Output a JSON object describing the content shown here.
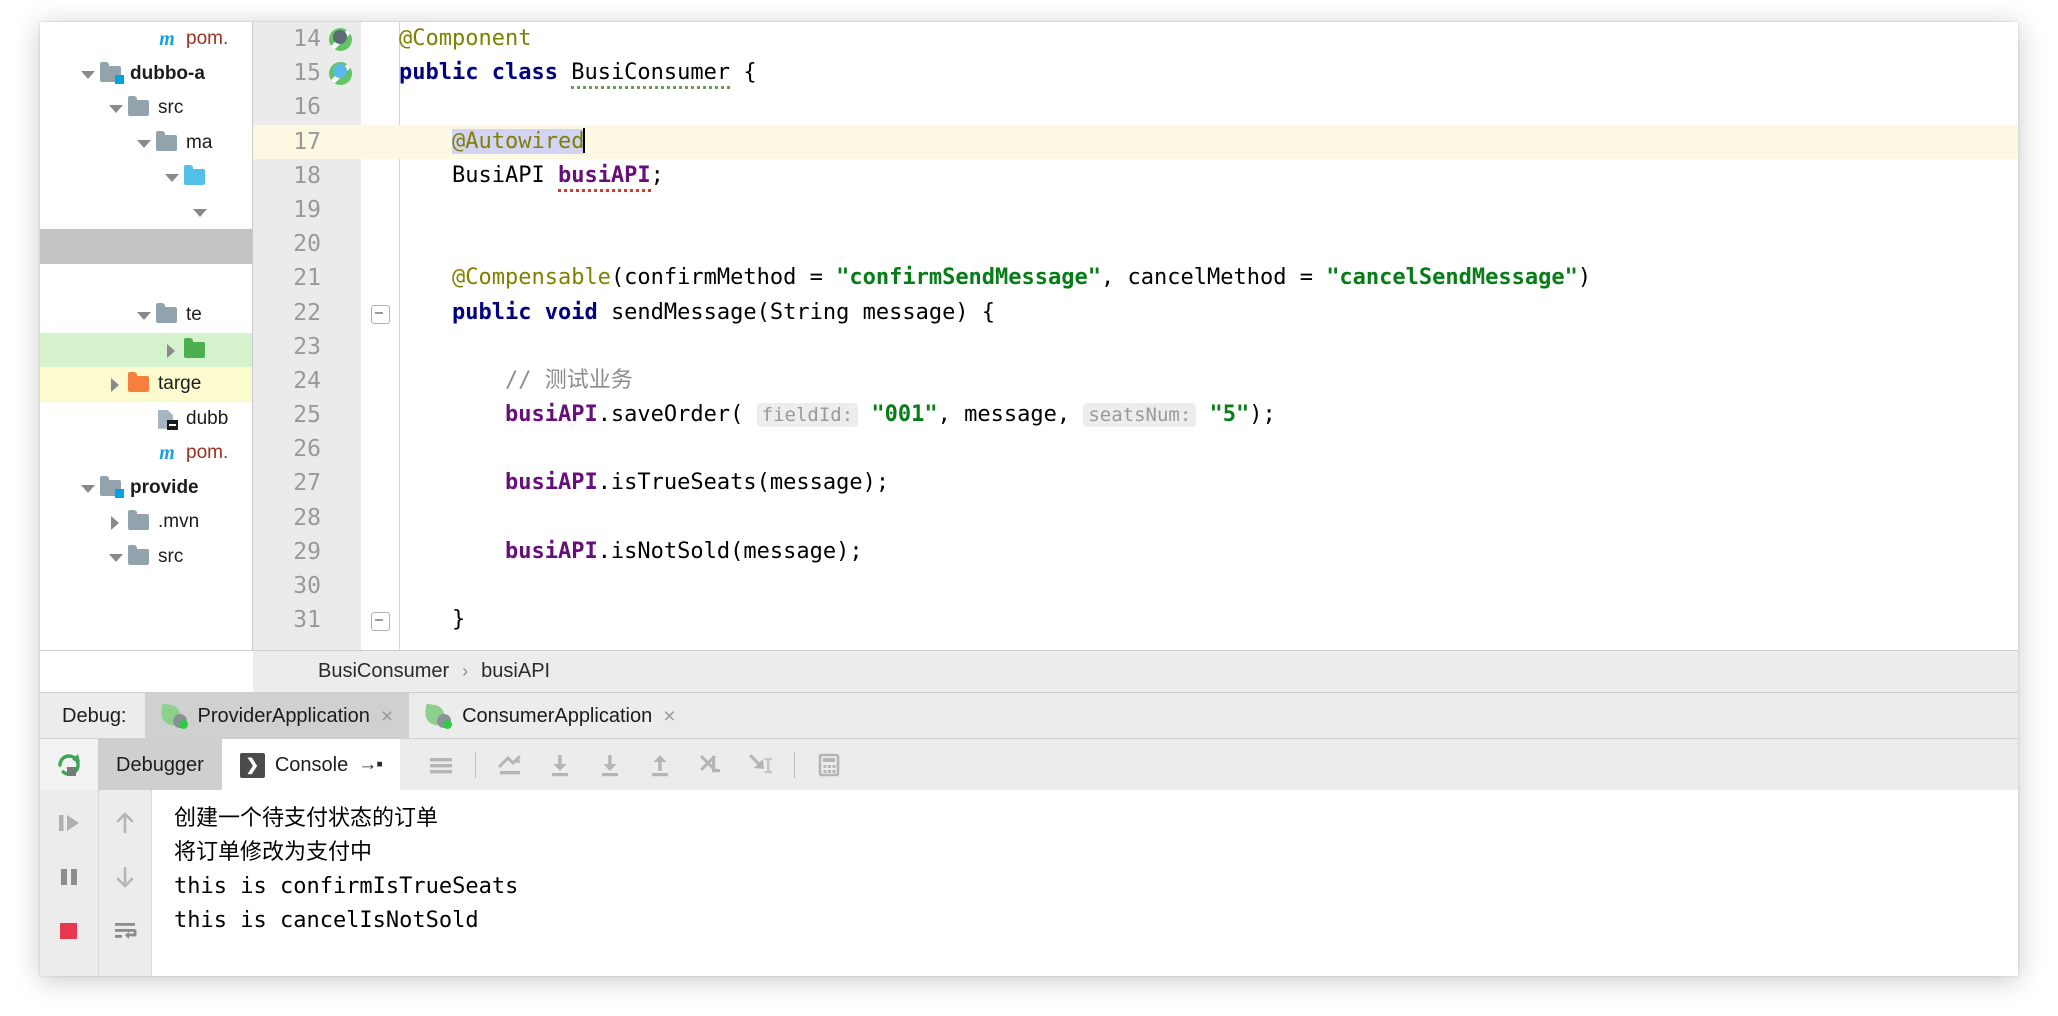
{
  "project_tree": {
    "items": [
      {
        "id": "pom-top",
        "indent": 3,
        "arrow": "none",
        "icon": "maven-pom-icon",
        "label": "pom.",
        "bold": false,
        "red": true,
        "highlight": "none"
      },
      {
        "id": "dubbo-a",
        "indent": 1,
        "arrow": "down",
        "icon": "module-folder-icon",
        "label": "dubbo-a",
        "bold": true,
        "red": false,
        "highlight": "none"
      },
      {
        "id": "src",
        "indent": 2,
        "arrow": "down",
        "icon": "folder-grey-icon",
        "label": "src",
        "bold": false,
        "red": false,
        "highlight": "none"
      },
      {
        "id": "main",
        "indent": 3,
        "arrow": "down",
        "icon": "folder-grey-icon",
        "label": "ma",
        "bold": false,
        "red": false,
        "highlight": "none"
      },
      {
        "id": "java",
        "indent": 4,
        "arrow": "down",
        "icon": "folder-blue-icon",
        "label": "",
        "bold": false,
        "red": false,
        "highlight": "none"
      },
      {
        "id": "pkg",
        "indent": 5,
        "arrow": "down",
        "icon": "none",
        "label": "",
        "bold": false,
        "red": false,
        "highlight": "none"
      },
      {
        "id": "selected-grey",
        "indent": 0,
        "arrow": "none",
        "icon": "none",
        "label": "",
        "bold": false,
        "red": false,
        "highlight": "grey"
      },
      {
        "id": "blank-a",
        "indent": 0,
        "arrow": "none",
        "icon": "none",
        "label": "",
        "bold": false,
        "red": false,
        "highlight": "none"
      },
      {
        "id": "test",
        "indent": 3,
        "arrow": "down",
        "icon": "folder-grey-icon",
        "label": "te",
        "bold": false,
        "red": false,
        "highlight": "none"
      },
      {
        "id": "resources",
        "indent": 4,
        "arrow": "right",
        "icon": "folder-green-icon",
        "label": "",
        "bold": false,
        "red": false,
        "highlight": "green"
      },
      {
        "id": "target",
        "indent": 2,
        "arrow": "right",
        "icon": "folder-orange-icon",
        "label": "targe",
        "bold": false,
        "red": false,
        "highlight": "yellow"
      },
      {
        "id": "dubbo-xml",
        "indent": 3,
        "arrow": "none",
        "icon": "xml-file-icon",
        "label": "dubb",
        "bold": false,
        "red": false,
        "highlight": "none"
      },
      {
        "id": "pom-mid",
        "indent": 3,
        "arrow": "none",
        "icon": "maven-pom-icon",
        "label": "pom.",
        "bold": false,
        "red": true,
        "highlight": "none"
      },
      {
        "id": "provider",
        "indent": 1,
        "arrow": "down",
        "icon": "module-folder-icon",
        "label": "provide",
        "bold": true,
        "red": false,
        "highlight": "none"
      },
      {
        "id": "mvn",
        "indent": 2,
        "arrow": "right",
        "icon": "folder-grey-icon",
        "label": ".mvn",
        "bold": false,
        "red": false,
        "highlight": "none"
      },
      {
        "id": "src2",
        "indent": 2,
        "arrow": "down",
        "icon": "folder-grey-icon",
        "label": "src",
        "bold": false,
        "red": false,
        "highlight": "none"
      }
    ]
  },
  "editor": {
    "lines": [
      {
        "no": "14",
        "gutter_icon": "spring-bean-icon",
        "fold": false,
        "highlight": false,
        "tokens": [
          {
            "t": "@Component",
            "c": "ann"
          }
        ]
      },
      {
        "no": "15",
        "gutter_icon": "spring-config-icon",
        "fold": false,
        "highlight": false,
        "tokens": [
          {
            "t": "public ",
            "c": "kw"
          },
          {
            "t": "class ",
            "c": "kw"
          },
          {
            "t": "BusiConsumer",
            "c": "plain wavy-green"
          },
          {
            "t": " {",
            "c": "plain"
          }
        ]
      },
      {
        "no": "16",
        "gutter_icon": "none",
        "fold": false,
        "highlight": false,
        "tokens": []
      },
      {
        "no": "17",
        "gutter_icon": "none",
        "fold": false,
        "highlight": true,
        "tokens": [
          {
            "t": "    ",
            "c": "plain"
          },
          {
            "t": "@Autowired",
            "c": "ann sel-token"
          },
          {
            "t": "|CARET|",
            "c": "caret"
          }
        ]
      },
      {
        "no": "18",
        "gutter_icon": "none",
        "fold": false,
        "highlight": false,
        "tokens": [
          {
            "t": "    BusiAPI ",
            "c": "plain"
          },
          {
            "t": "busiAPI",
            "c": "fld wavy-red"
          },
          {
            "t": ";",
            "c": "plain"
          }
        ]
      },
      {
        "no": "19",
        "gutter_icon": "none",
        "fold": false,
        "highlight": false,
        "tokens": []
      },
      {
        "no": "20",
        "gutter_icon": "none",
        "fold": false,
        "highlight": false,
        "tokens": []
      },
      {
        "no": "21",
        "gutter_icon": "none",
        "fold": false,
        "highlight": false,
        "tokens": [
          {
            "t": "    ",
            "c": "plain"
          },
          {
            "t": "@Compensable",
            "c": "ann"
          },
          {
            "t": "(confirmMethod = ",
            "c": "plain"
          },
          {
            "t": "\"confirmSendMessage\"",
            "c": "str"
          },
          {
            "t": ", cancelMethod = ",
            "c": "plain"
          },
          {
            "t": "\"cancelSendMessage\"",
            "c": "str"
          },
          {
            "t": ")",
            "c": "plain"
          }
        ]
      },
      {
        "no": "22",
        "gutter_icon": "none",
        "fold": true,
        "highlight": false,
        "tokens": [
          {
            "t": "    ",
            "c": "plain"
          },
          {
            "t": "public ",
            "c": "kw"
          },
          {
            "t": "void ",
            "c": "kw"
          },
          {
            "t": "sendMessage(String message) {",
            "c": "plain"
          }
        ]
      },
      {
        "no": "23",
        "gutter_icon": "none",
        "fold": false,
        "highlight": false,
        "tokens": []
      },
      {
        "no": "24",
        "gutter_icon": "none",
        "fold": false,
        "highlight": false,
        "tokens": [
          {
            "t": "        ",
            "c": "plain"
          },
          {
            "t": "// 测试业务",
            "c": "cmt"
          }
        ]
      },
      {
        "no": "25",
        "gutter_icon": "none",
        "fold": false,
        "highlight": false,
        "tokens": [
          {
            "t": "        ",
            "c": "plain"
          },
          {
            "t": "busiAPI",
            "c": "fld"
          },
          {
            "t": ".saveOrder( ",
            "c": "plain"
          },
          {
            "t": "fieldId:",
            "c": "hint"
          },
          {
            "t": " ",
            "c": "plain"
          },
          {
            "t": "\"001\"",
            "c": "str"
          },
          {
            "t": ", message, ",
            "c": "plain"
          },
          {
            "t": "seatsNum:",
            "c": "hint"
          },
          {
            "t": " ",
            "c": "plain"
          },
          {
            "t": "\"5\"",
            "c": "str"
          },
          {
            "t": ");",
            "c": "plain"
          }
        ]
      },
      {
        "no": "26",
        "gutter_icon": "none",
        "fold": false,
        "highlight": false,
        "tokens": []
      },
      {
        "no": "27",
        "gutter_icon": "none",
        "fold": false,
        "highlight": false,
        "tokens": [
          {
            "t": "        ",
            "c": "plain"
          },
          {
            "t": "busiAPI",
            "c": "fld"
          },
          {
            "t": ".isTrueSeats(message);",
            "c": "plain"
          }
        ]
      },
      {
        "no": "28",
        "gutter_icon": "none",
        "fold": false,
        "highlight": false,
        "tokens": []
      },
      {
        "no": "29",
        "gutter_icon": "none",
        "fold": false,
        "highlight": false,
        "tokens": [
          {
            "t": "        ",
            "c": "plain"
          },
          {
            "t": "busiAPI",
            "c": "fld"
          },
          {
            "t": ".isNotSold(message);",
            "c": "plain"
          }
        ]
      },
      {
        "no": "30",
        "gutter_icon": "none",
        "fold": false,
        "highlight": false,
        "tokens": []
      },
      {
        "no": "31",
        "gutter_icon": "none",
        "fold": true,
        "highlight": false,
        "tokens": [
          {
            "t": "    }",
            "c": "plain"
          }
        ]
      }
    ]
  },
  "breadcrumb": {
    "class_name": "BusiConsumer",
    "separator": "›",
    "member_name": "busiAPI"
  },
  "debug_bar": {
    "label": "Debug:",
    "tabs": [
      {
        "id": "provider",
        "label": "ProviderApplication",
        "active": true,
        "close": "×",
        "icon": "spring-boot-run-icon"
      },
      {
        "id": "consumer",
        "label": "ConsumerApplication",
        "active": false,
        "close": "×",
        "icon": "spring-boot-run-icon"
      }
    ]
  },
  "debug_toolbar": {
    "rerun_icon": "rerun-icon",
    "tabs": [
      {
        "id": "debugger",
        "label": "Debugger",
        "active": false,
        "icon": "none"
      },
      {
        "id": "console",
        "label": "Console",
        "active": true,
        "icon": "console-icon",
        "pin": "→▪"
      }
    ],
    "actions": [
      {
        "id": "show-execution-point",
        "icon": "lines-icon",
        "name": "layout-settings-icon"
      },
      {
        "id": "sep1",
        "icon": "separator",
        "name": "toolbar-separator"
      },
      {
        "id": "show-exec",
        "icon": "show-exec-point-icon",
        "name": "show-execution-point-icon"
      },
      {
        "id": "step-over",
        "icon": "step-over-icon",
        "name": "step-over-icon"
      },
      {
        "id": "step-into",
        "icon": "step-into-icon",
        "name": "step-into-icon"
      },
      {
        "id": "step-out",
        "icon": "step-out-icon",
        "name": "step-out-icon"
      },
      {
        "id": "drop-frame",
        "icon": "drop-frame-icon",
        "name": "drop-frame-icon"
      },
      {
        "id": "run-to-cursor",
        "icon": "run-to-cursor-icon",
        "name": "run-to-cursor-icon"
      },
      {
        "id": "sep2",
        "icon": "separator",
        "name": "toolbar-separator"
      },
      {
        "id": "evaluate",
        "icon": "evaluate-icon",
        "name": "evaluate-expression-icon"
      }
    ]
  },
  "console_side": {
    "run_actions": [
      {
        "id": "resume",
        "icon": "resume-program-icon"
      },
      {
        "id": "pause",
        "icon": "pause-program-icon"
      },
      {
        "id": "stop",
        "icon": "stop-icon"
      }
    ],
    "nav_actions": [
      {
        "id": "up",
        "icon": "arrow-up-icon"
      },
      {
        "id": "down",
        "icon": "arrow-down-icon"
      },
      {
        "id": "softwrap",
        "icon": "soft-wrap-icon"
      }
    ]
  },
  "console": {
    "lines": [
      {
        "text": "创建一个待支付状态的订单",
        "cjk": true
      },
      {
        "text": "将订单修改为支付中",
        "cjk": true
      },
      {
        "text": "this is confirmIsTrueSeats",
        "cjk": false
      },
      {
        "text": "this is cancelIsNotSold",
        "cjk": false
      }
    ]
  },
  "colors": {
    "keyword": "#000080",
    "annotation": "#808000",
    "string": "#067d17",
    "field": "#660e7a",
    "comment": "#8c8c8c",
    "line_highlight": "#fdf8e2",
    "selection": "#d3d3f5",
    "tree_selected": "#c4c4c4",
    "tree_green": "#d3f2cd",
    "tree_yellow": "#fcfbd0",
    "stop_red": "#e8384f",
    "resume_green": "#3aa655"
  }
}
